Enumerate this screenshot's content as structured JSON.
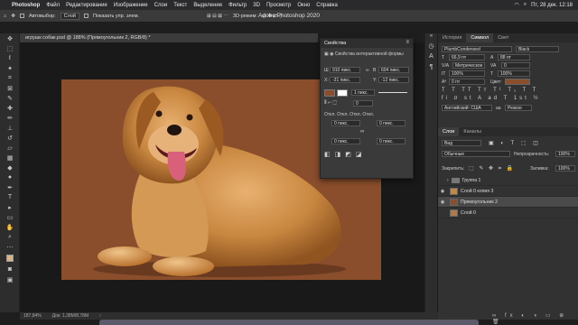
{
  "menubar": {
    "app_name": "Photoshop",
    "items": [
      "Файл",
      "Редактирование",
      "Изображение",
      "Слои",
      "Текст",
      "Выделение",
      "Фильтр",
      "3D",
      "Просмотр",
      "Окно",
      "Справка"
    ],
    "clock": "Пт, 28 дек.  12:18"
  },
  "window_title": "Adobe Photoshop 2020",
  "options": {
    "autoselect_label": "Автовыбор:",
    "autoselect_value": "Слой",
    "show_controls_label": "Показать упр. элем.",
    "mode_3d_label": "3D-режим:"
  },
  "document": {
    "tab_label": "игрушк собак.psd @ 188% (Прямоугольник 2, RGB/8) *",
    "zoom": "187,84%",
    "doc_size": "Док: 1,38M/8,78M"
  },
  "properties": {
    "title": "Свойства",
    "subtitle": "Свойства интерактивной формы",
    "w_label": "Ш",
    "w_value": "910 пикс.",
    "h_label": "В",
    "h_value": "604 пикс.",
    "x_label": "X:",
    "x_value": "-31 пикс.",
    "y_label": "Y:",
    "y_value": "-12 пикс.",
    "stroke_value": "1 пикс.",
    "radius_header": "Откл. Откл. Откл. Откл.",
    "corner1": "0 пикс.",
    "corner2": "0 пикс.",
    "corner3": "0 пикс.",
    "corner4": "0 пикс."
  },
  "character": {
    "tabs": [
      "История",
      "Символ",
      "Свет"
    ],
    "font": "PlumbCondensed",
    "style": "Black",
    "size": "66,9 пт",
    "leading": "88 пт",
    "kerning": "Метрическое",
    "tracking": "0",
    "vscale": "100%",
    "hscale": "100%",
    "baseline": "0 пт",
    "color_label": "Цвет:",
    "language": "Английский: США",
    "aa": "Резкое",
    "text_color": "#8a4e2c"
  },
  "layers": {
    "tabs": [
      "Слои",
      "Каналы"
    ],
    "filter_kind": "Вид",
    "blend_mode": "Обычные",
    "opacity_label": "Непрозрачность:",
    "opacity_value": "100%",
    "lock_label": "Закрепить:",
    "fill_label": "Заливка:",
    "fill_value": "100%",
    "items": [
      {
        "name": "Группа 1",
        "type": "group",
        "visible": false,
        "selected": false
      },
      {
        "name": "Слой 0 копия 3",
        "type": "layer",
        "visible": true,
        "selected": false
      },
      {
        "name": "Прямоугольник 2",
        "type": "shape",
        "visible": true,
        "selected": true
      },
      {
        "name": "Слой 0",
        "type": "layer",
        "visible": false,
        "selected": false
      }
    ]
  },
  "colors": {
    "background_brown": "#8a4e2c",
    "panel": "#323232",
    "canvas": "#191919"
  }
}
